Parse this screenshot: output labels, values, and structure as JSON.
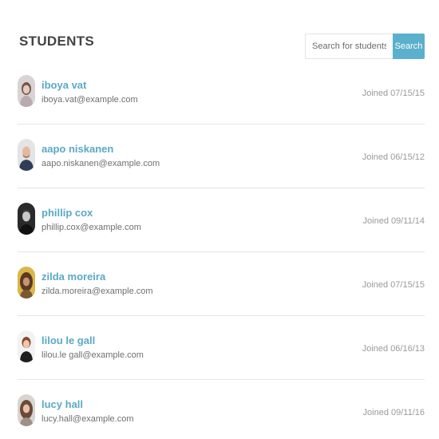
{
  "header": {
    "title": "STUDENTS",
    "search_placeholder": "Search for students...",
    "search_button": "Search"
  },
  "colors": {
    "accent": "#5ab0cd",
    "name_link": "#5aa9c6"
  },
  "students": [
    {
      "name": "iboya vat",
      "email": "iboya.vat@example.com",
      "joined": "Joined 07/15/15",
      "avatar": "student-photo"
    },
    {
      "name": "aapo niskanen",
      "email": "aapo.niskanen@example.com",
      "joined": "Joined 06/15/12",
      "avatar": "student-photo"
    },
    {
      "name": "phillip cox",
      "email": "phillip.cox@example.com",
      "joined": "Joined 09/11/14",
      "avatar": "student-photo"
    },
    {
      "name": "zilda moreira",
      "email": "zilda.moreira@example.com",
      "joined": "Joined 07/15/15",
      "avatar": "student-photo"
    },
    {
      "name": "lilou le gall",
      "email": "lilou.le gall@example.com",
      "joined": "Joined 06/16/13",
      "avatar": "student-photo"
    },
    {
      "name": "lucy hall",
      "email": "lucy.hall@example.com",
      "joined": "Joined 09/11/16",
      "avatar": "student-photo"
    }
  ]
}
